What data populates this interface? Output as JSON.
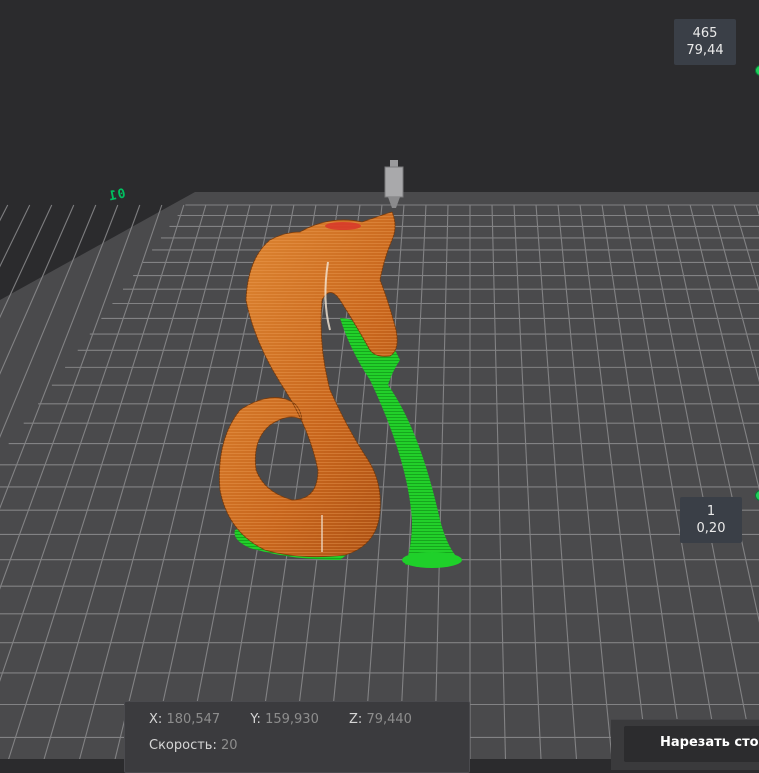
{
  "viewport": {
    "bed_label": "01",
    "colors": {
      "background": "#2b2b2d",
      "bed": "#4a4a4c",
      "grid": "#8a8a8c",
      "model": "#d9782a",
      "support": "#2ee02e"
    }
  },
  "layer_slider": {
    "top": {
      "layer": "465",
      "height": "79,44"
    },
    "bottom": {
      "layer": "1",
      "height": "0,20"
    }
  },
  "position_readout": {
    "x_label": "X:",
    "x_value": "180,547",
    "y_label": "Y:",
    "y_value": "159,930",
    "z_label": "Z:",
    "z_value": "79,440",
    "speed_label": "Скорость:",
    "speed_value": "20"
  },
  "actions": {
    "slice_label": "Нарезать сто"
  },
  "icons": {
    "nozzle": "nozzle-icon"
  }
}
